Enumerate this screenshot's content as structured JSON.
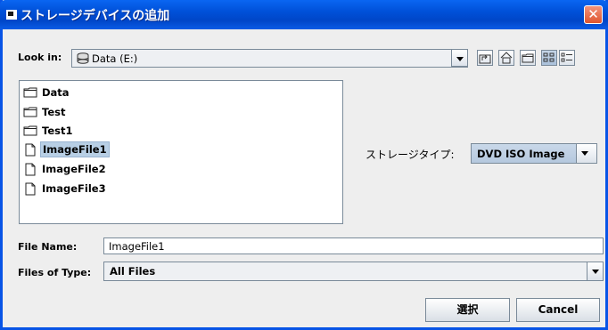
{
  "window": {
    "title": "ストレージデバイスの追加",
    "close_glyph": "✕"
  },
  "look_in": {
    "label": "Look in:",
    "value": "Data (E:)"
  },
  "files": [
    {
      "name": "Data",
      "type": "folder"
    },
    {
      "name": "Test",
      "type": "folder"
    },
    {
      "name": "Test1",
      "type": "folder"
    },
    {
      "name": "ImageFile1",
      "type": "file",
      "selected": true
    },
    {
      "name": "ImageFile2",
      "type": "file"
    },
    {
      "name": "ImageFile3",
      "type": "file"
    }
  ],
  "storage_type": {
    "label": "ストレージタイプ:",
    "value": "DVD ISO Image"
  },
  "file_name": {
    "label": "File Name:",
    "value": "ImageFile1"
  },
  "files_of_type": {
    "label": "Files of Type:",
    "value": "All Files"
  },
  "buttons": {
    "select": "選択",
    "cancel": "Cancel"
  },
  "colors": {
    "title_bar": "#0054E3",
    "selection": "#B8CFE5",
    "close": "#E0552E"
  }
}
